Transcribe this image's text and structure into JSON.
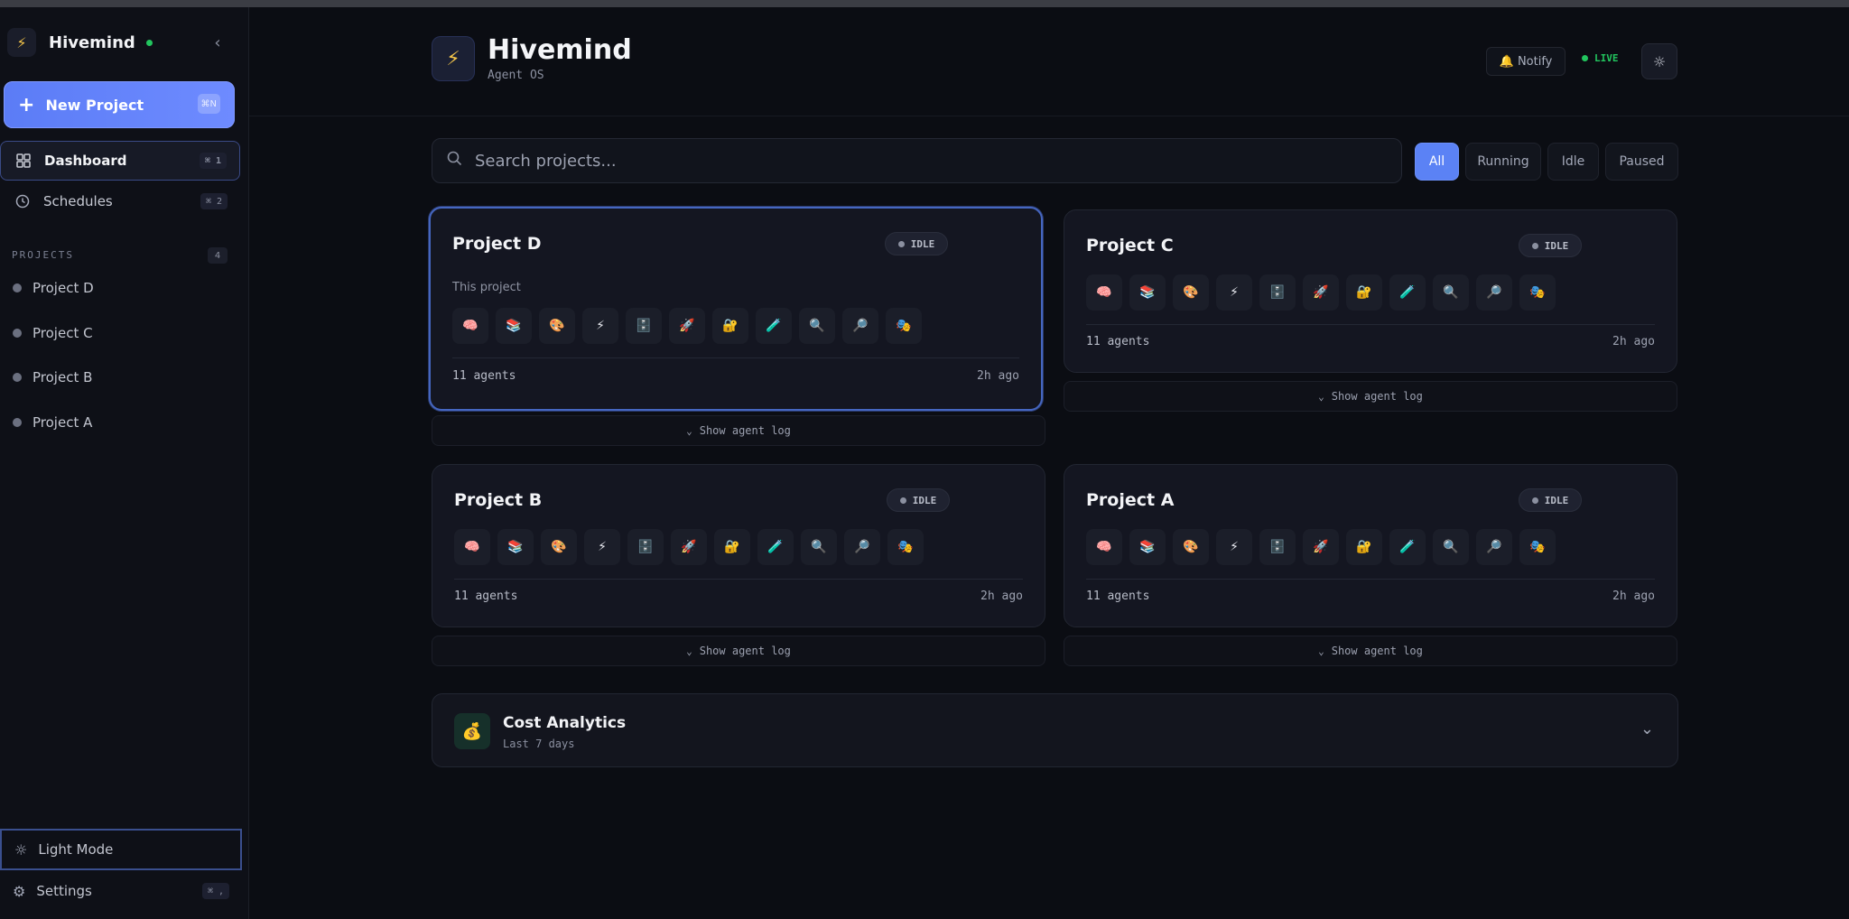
{
  "sidebar": {
    "brand": "Hivemind",
    "brand_icon": "⚡",
    "collapse_icon": "‹",
    "new_project": {
      "plus": "+",
      "label": "New Project",
      "shortcut": "⌘N"
    },
    "nav": [
      {
        "label": "Dashboard",
        "shortcut": "⌘ 1",
        "icon": "grid-icon"
      },
      {
        "label": "Schedules",
        "shortcut": "⌘ 2",
        "icon": "clock-icon"
      }
    ],
    "projects_label": "PROJECTS",
    "projects_count": "4",
    "projects": [
      "Project D",
      "Project C",
      "Project B",
      "Project A"
    ],
    "light_mode": "Light Mode",
    "settings": "Settings",
    "settings_shortcut": "⌘ ,"
  },
  "header": {
    "logo_icon": "⚡",
    "title": "Hivemind",
    "subtitle": "Agent OS",
    "notify": "🔔 Notify",
    "live": "LIVE",
    "theme_icon": "☼"
  },
  "search": {
    "placeholder": "Search projects...",
    "icon": "⌕"
  },
  "filters": [
    "All",
    "Running",
    "Idle",
    "Paused"
  ],
  "agent_icons": [
    "🧠",
    "📚",
    "🎨",
    "⚡",
    "🗄️",
    "🚀",
    "🔐",
    "🧪",
    "🔍",
    "🔎",
    "🎭"
  ],
  "cards": [
    {
      "title": "Project D",
      "status": "IDLE",
      "description": "This project",
      "agents": "11 agents",
      "time": "2h ago"
    },
    {
      "title": "Project C",
      "status": "IDLE",
      "description": "",
      "agents": "11 agents",
      "time": "2h ago"
    },
    {
      "title": "Project B",
      "status": "IDLE",
      "description": "",
      "agents": "11 agents",
      "time": "2h ago"
    },
    {
      "title": "Project A",
      "status": "IDLE",
      "description": "",
      "agents": "11 agents",
      "time": "2h ago"
    }
  ],
  "log_label": "Show agent log",
  "log_chevron": "⌄",
  "cost": {
    "icon": "💰",
    "title": "Cost Analytics",
    "subtitle": "Last 7 days",
    "chevron": "⌄"
  },
  "colors": {
    "accent": "#5b82f5",
    "live": "#22c55e",
    "bg": "#0b0d13"
  }
}
